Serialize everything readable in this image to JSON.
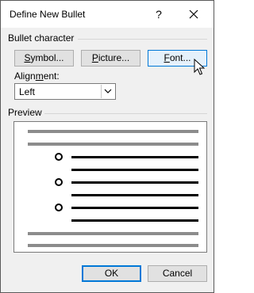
{
  "window": {
    "title": "Define New Bullet",
    "help_label": "?"
  },
  "bullet_character": {
    "group_label": "Bullet character",
    "symbol_button": {
      "mnemonic": "S",
      "rest": "ymbol..."
    },
    "picture_button": {
      "mnemonic": "P",
      "rest": "icture..."
    },
    "font_button": {
      "mnemonic": "F",
      "rest": "ont..."
    }
  },
  "alignment": {
    "label_mnemonic": "m",
    "label_before": "Align",
    "label_after": "ent:",
    "value": "Left"
  },
  "preview": {
    "group_label": "Preview",
    "bullet_count": 3
  },
  "footer": {
    "ok_label": "OK",
    "cancel_label": "Cancel"
  }
}
